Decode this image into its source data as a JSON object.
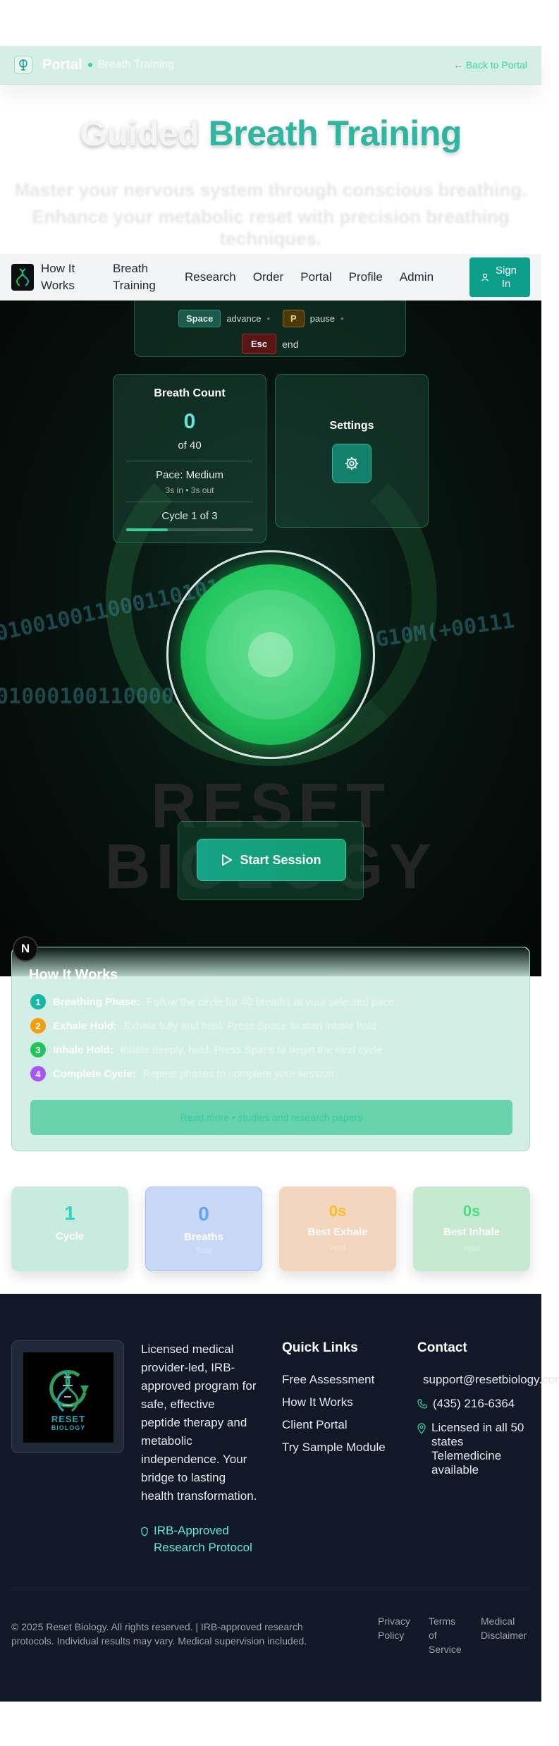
{
  "portal_bar": {
    "title": "Portal",
    "subtitle": "Breath Training",
    "back_link": "← Back to Portal"
  },
  "hero": {
    "title_part1": "Guided",
    "title_part2": "Breath Training",
    "subtitle_line1": "Master your nervous system through conscious breathing.",
    "subtitle_line2": "Enhance your metabolic reset with precision breathing techniques."
  },
  "nav": {
    "items": [
      "How It Works",
      "Breath Training",
      "Research",
      "Order",
      "Portal",
      "Profile",
      "Admin"
    ],
    "sign_in": "Sign In"
  },
  "shortcuts": {
    "space_key": "Space",
    "space_action": "advance",
    "pause_key": "P",
    "pause_action": "pause",
    "esc_key": "Esc",
    "esc_action": "end"
  },
  "breath_count": {
    "title": "Breath Count",
    "count": "0",
    "of_total": "of 40",
    "pace": "Pace: Medium",
    "pace_detail": "3s in • 3s out",
    "cycle": "Cycle 1 of 3",
    "progress": 0.33
  },
  "settings": {
    "title": "Settings",
    "icon": "gear-icon"
  },
  "background": {
    "code_line1": "0100100110001101011",
    "code_line2": "01000100110000",
    "code_line3": "G10M(+00111",
    "brand_word1": "RESET",
    "brand_word2": "BIOLOGY"
  },
  "start_button": "Start Session",
  "n_badge": "N",
  "how_it_works": {
    "title": "How It Works",
    "steps": [
      {
        "num": "1",
        "head": "Breathing Phase:",
        "text": "Follow the circle for 40 breaths at your selected pace",
        "color": "#14b8a6"
      },
      {
        "num": "2",
        "head": "Exhale Hold:",
        "text": "Exhale fully and hold. Press Space to start inhale hold",
        "color": "#f59e0b"
      },
      {
        "num": "3",
        "head": "Inhale Hold:",
        "text": "Inhale deeply, hold. Press Space to begin the next cycle",
        "color": "#22c55e"
      },
      {
        "num": "4",
        "head": "Complete Cycle:",
        "text": "Repeat phases to complete your session",
        "color": "#a855f7"
      }
    ],
    "link": "Read more • studies and research papers"
  },
  "stats": [
    {
      "value": "1",
      "label": "Cycle",
      "note": "",
      "bg": "#c8ebe0",
      "color": "#2dd4bf"
    },
    {
      "value": "0",
      "label": "Breaths",
      "note": "Total",
      "bg": "#c9d8f7",
      "color": "#60a5fa"
    },
    {
      "value": "0s",
      "label": "Best Exhale",
      "note": "Hold",
      "bg": "#f3d6bd",
      "color": "#fbbf24"
    },
    {
      "value": "0s",
      "label": "Best Inhale",
      "note": "Hold",
      "bg": "#c5ead0",
      "color": "#4ade80"
    }
  ],
  "footer": {
    "logo_text1": "RESET",
    "logo_text2": "BIOLOGY",
    "about_lines": [
      "Licensed medical",
      "provider-led, IRB-",
      "approved program for",
      "safe, effective",
      "peptide therapy and",
      "metabolic",
      "independence. Your",
      "bridge to lasting",
      "health transformation."
    ],
    "irb_line1": "IRB-Approved",
    "irb_line2": "Research Protocol",
    "quick_links_title": "Quick Links",
    "quick_links": [
      "Free Assessment",
      "How It Works",
      "Client Portal",
      "Try Sample Module"
    ],
    "contact_title": "Contact",
    "email": "support@resetbiology.com",
    "phone": "(435) 216-6364",
    "license_line1": "Licensed in all 50",
    "license_line2": "states",
    "license_line3": "Telemedicine",
    "license_line4": "available",
    "copyright_line1": "© 2025 Reset Biology. All rights reserved. | IRB-approved research",
    "copyright_line2": "protocols. Individual results may vary. Medical supervision included.",
    "privacy_line1": "Privacy",
    "privacy_line2": "Policy",
    "terms_line1": "Terms",
    "terms_line2": "of",
    "terms_line3": "Service",
    "disclaimer_line1": "Medical",
    "disclaimer_line2": "Disclaimer"
  }
}
